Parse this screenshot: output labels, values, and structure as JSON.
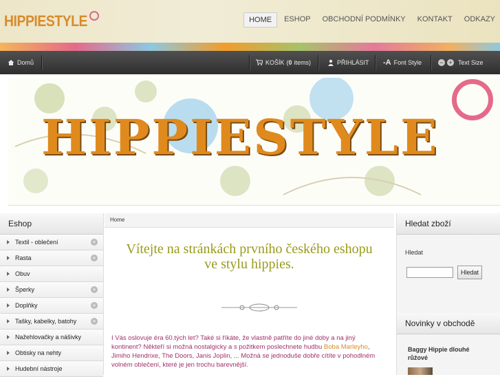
{
  "logo": {
    "text": "HIPPIESTYLE"
  },
  "topnav": [
    {
      "label": "HOME",
      "active": true
    },
    {
      "label": "ESHOP",
      "active": false
    },
    {
      "label": "OBCHODNÍ PODMÍNKY",
      "active": false
    },
    {
      "label": "KONTAKT",
      "active": false
    },
    {
      "label": "ODKAZY",
      "active": false
    }
  ],
  "toolbar": {
    "home": "Domů",
    "cart_label": "KOŠÍK",
    "cart_count": "0",
    "cart_items": "items",
    "login": "PŘIHLÁSIT",
    "font_style": "Font Style",
    "text_size": "Text Size"
  },
  "banner": {
    "text": "HIPPIESTYLE"
  },
  "eshop": {
    "title": "Eshop",
    "categories": [
      {
        "label": "Textil - oblečení",
        "expandable": true
      },
      {
        "label": "Rasta",
        "expandable": true
      },
      {
        "label": "Obuv",
        "expandable": false
      },
      {
        "label": "Šperky",
        "expandable": true
      },
      {
        "label": "Doplňky",
        "expandable": true
      },
      {
        "label": "Tašky, kabelky, batohy",
        "expandable": true
      },
      {
        "label": "Nažehlovačky a nášivky",
        "expandable": false
      },
      {
        "label": "Obtisky na nehty",
        "expandable": false
      },
      {
        "label": "Hudební nástroje",
        "expandable": false
      }
    ]
  },
  "main": {
    "breadcrumb": "Home",
    "welcome_line1": "Vítejte na stránkách prvního českého eshopu",
    "welcome_line2": "ve stylu hippies.",
    "intro_part1": "I Vás oslovuje éra 60.tých let? Také si říkáte, že vlastně patříte do jiné doby a na jiný kontinent? Někteří si možná nostalgicky a s požitkem poslechnete hudbu ",
    "intro_highlight": "Boba Marleyho",
    "intro_part2": ", Jimiho Hendrixe, The Doors, Janis Joplin, ... Možná se jednoduše dobře cítíte v pohodlném volném oblečení, které je jen trochu barevnější."
  },
  "search": {
    "title": "Hledat zboží",
    "label": "Hledat",
    "button": "Hledat"
  },
  "news": {
    "title": "Novinky v obchodě",
    "item_title": "Baggy Hippie dlouhé růžové"
  },
  "colors": {
    "accent_orange": "#e08a1e",
    "welcome_olive": "#9a9a1c",
    "intro_magenta": "#a0306a"
  }
}
